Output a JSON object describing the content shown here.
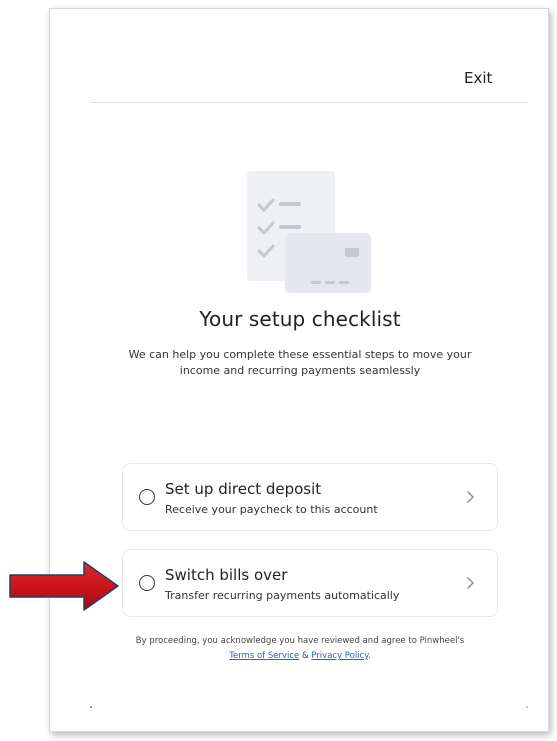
{
  "header": {
    "exit_label": "Exit"
  },
  "hero": {
    "icon": "checklist-card-illustration",
    "title": "Your setup checklist",
    "subtitle": "We can help you complete these essential steps to move your income and recurring payments seamlessly"
  },
  "checklist": [
    {
      "title": "Set up direct deposit",
      "description": "Receive your paycheck to this account",
      "chevron": ">"
    },
    {
      "title": "Switch bills over",
      "description": "Transfer recurring payments automatically",
      "chevron": ">"
    }
  ],
  "legal": {
    "prefix": "By proceeding, you acknowledge you have reviewed and agree to Pinwheel's ",
    "terms_label": "Terms of Service",
    "joiner": " & ",
    "privacy_label": "Privacy Policy",
    "suffix": "."
  },
  "annotation": {
    "icon": "red-arrow-pointer",
    "color": "#c8141a"
  },
  "colors": {
    "link": "#2f5fd0",
    "illustration_gray": "#eef0f3",
    "illustration_mark": "#c4c8cf"
  }
}
